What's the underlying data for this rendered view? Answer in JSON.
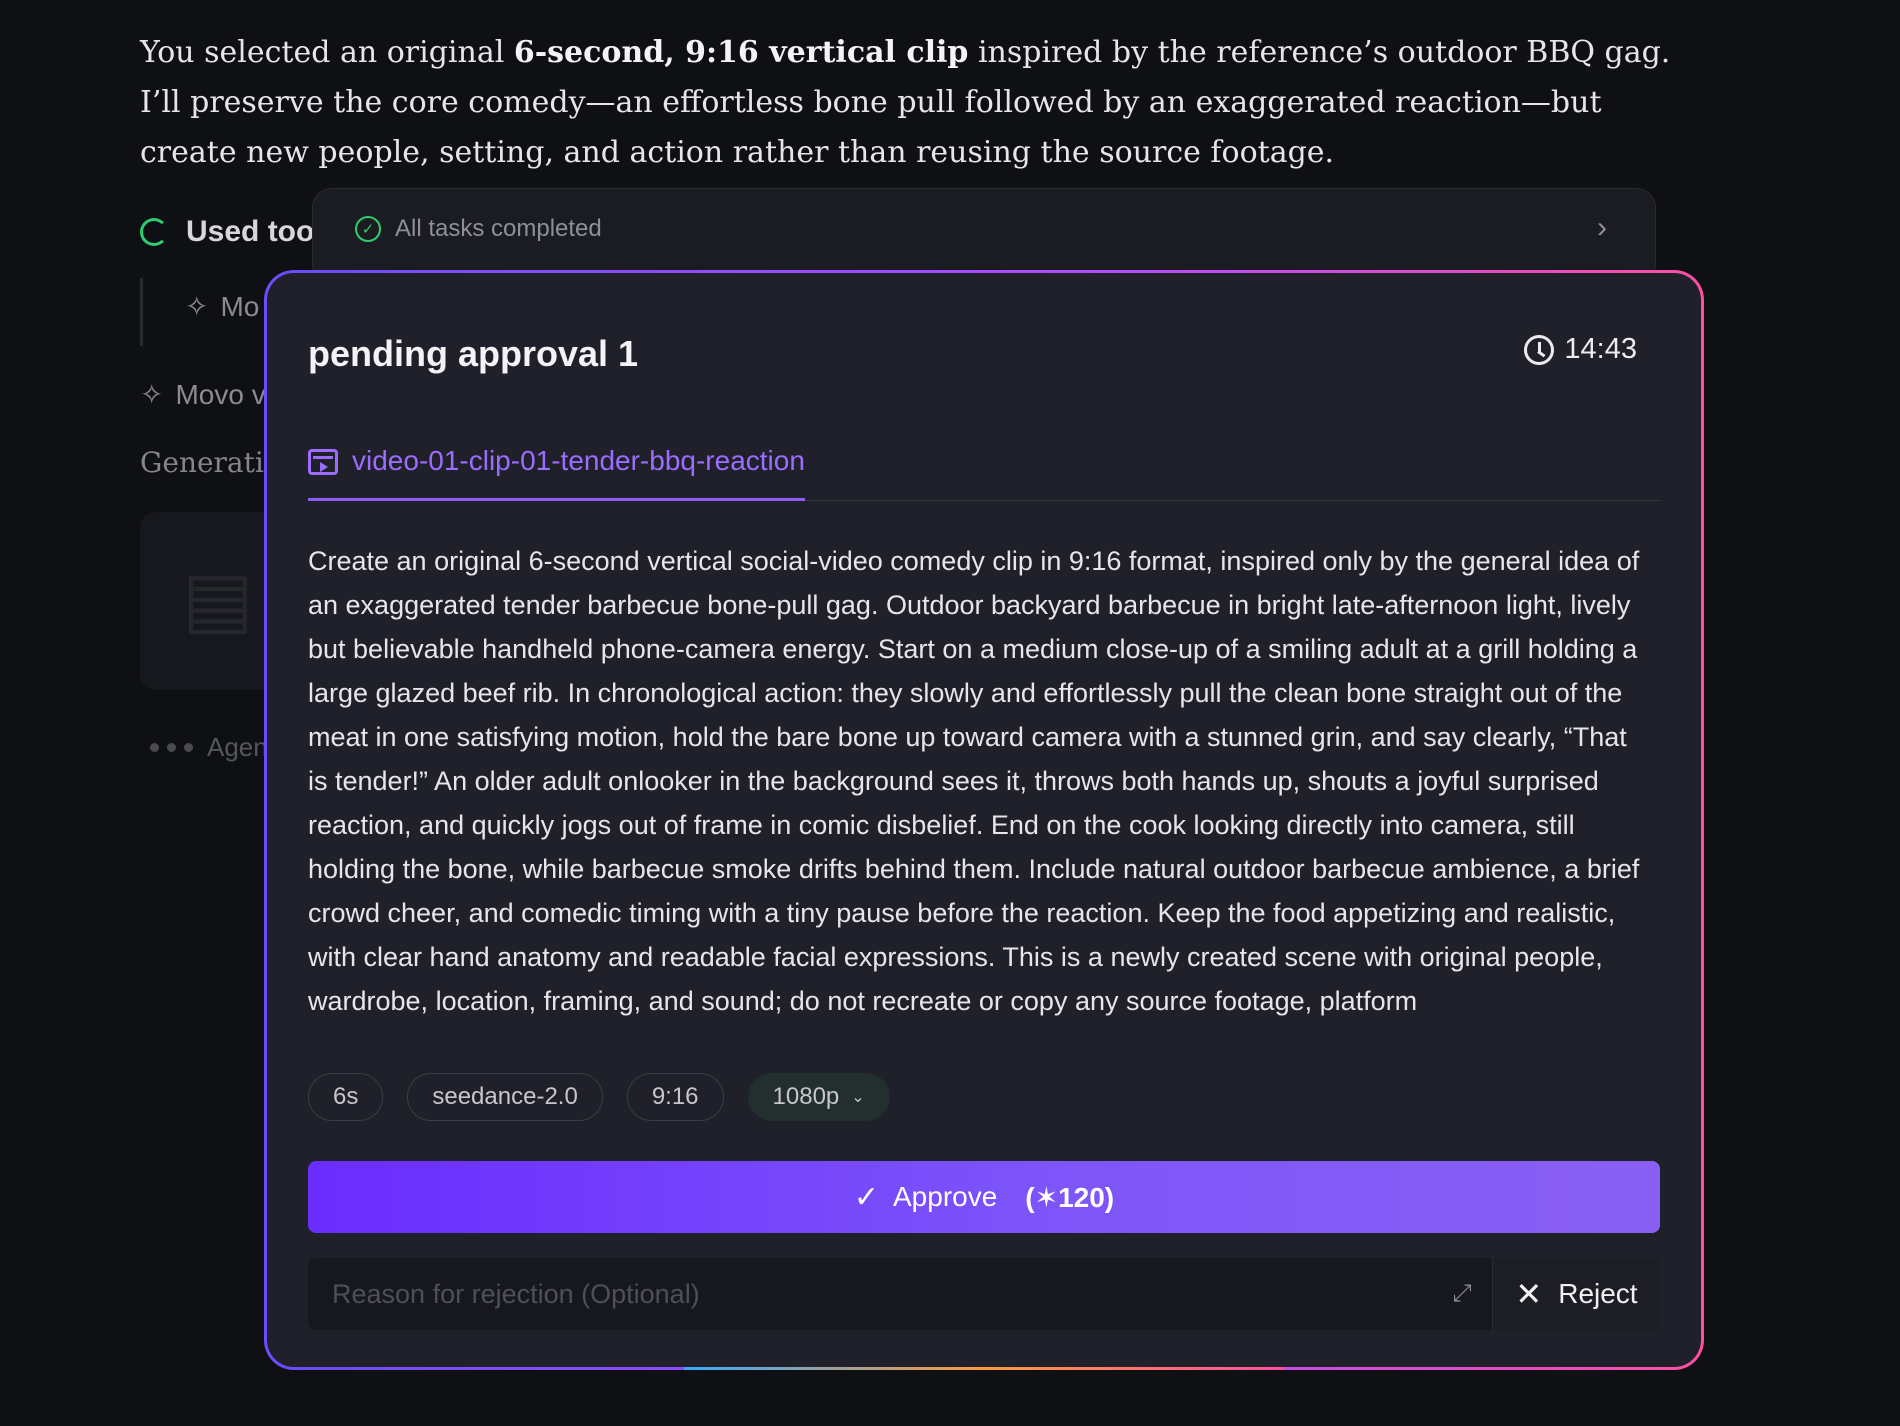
{
  "chat": {
    "msg_part1": "You selected an original ",
    "msg_bold": "6-second, 9:16 vertical clip",
    "msg_part2": " inspired by the reference’s outdoor BBQ gag. I’ll preserve the core comedy—an effortless bone pull followed by an exaggerated reaction—but create new people, setting, and action rather than reusing the source footage.",
    "used_tools": "Used tools",
    "tool_item": "Mo",
    "movo_item": "Movo v",
    "generating": "Generating",
    "agent": "Agent"
  },
  "task_bar": {
    "status": "All tasks completed"
  },
  "approval": {
    "title": "pending approval 1",
    "timer": "14:43",
    "tab_label": "video-01-clip-01-tender-bbq-reaction",
    "prompt": "Create an original 6-second vertical social-video comedy clip in 9:16 format, inspired only by the general idea of an exaggerated tender barbecue bone-pull gag. Outdoor backyard barbecue in bright late-afternoon light, lively but believable handheld phone-camera energy. Start on a medium close-up of a smiling adult at a grill holding a large glazed beef rib. In chronological action: they slowly and effortlessly pull the clean bone straight out of the meat in one satisfying motion, hold the bare bone up toward camera with a stunned grin, and say clearly, “That is tender!” An older adult onlooker in the background sees it, throws both hands up, shouts a joyful surprised reaction, and quickly jogs out of frame in comic disbelief. End on the cook looking directly into camera, still holding the bone, while barbecue smoke drifts behind them. Include natural outdoor barbecue ambience, a brief crowd cheer, and comedic timing with a tiny pause before the reaction. Keep the food appetizing and realistic, with clear hand anatomy and readable facial expressions. This is a newly created scene with original people, wardrobe, location, framing, and sound; do not recreate or copy any source footage, platform",
    "chips": {
      "duration": "6s",
      "model": "seedance-2.0",
      "ratio": "9:16",
      "resolution": "1080p"
    },
    "approve_label": "Approve",
    "approve_cost": "(✶120)",
    "reason_placeholder": "Reason for rejection (Optional)",
    "reject_label": "Reject"
  },
  "colors": {
    "accent": "#7b4dff",
    "success": "#2ecc71",
    "card_bg": "#1f2029",
    "page_bg": "#0f1014"
  },
  "icons": [
    "spinner-icon",
    "sparkle-icon",
    "check-circle-icon",
    "chevron-right-icon",
    "clock-icon",
    "video-clip-icon",
    "chevron-down-icon",
    "check-icon",
    "expand-icon",
    "close-icon"
  ]
}
